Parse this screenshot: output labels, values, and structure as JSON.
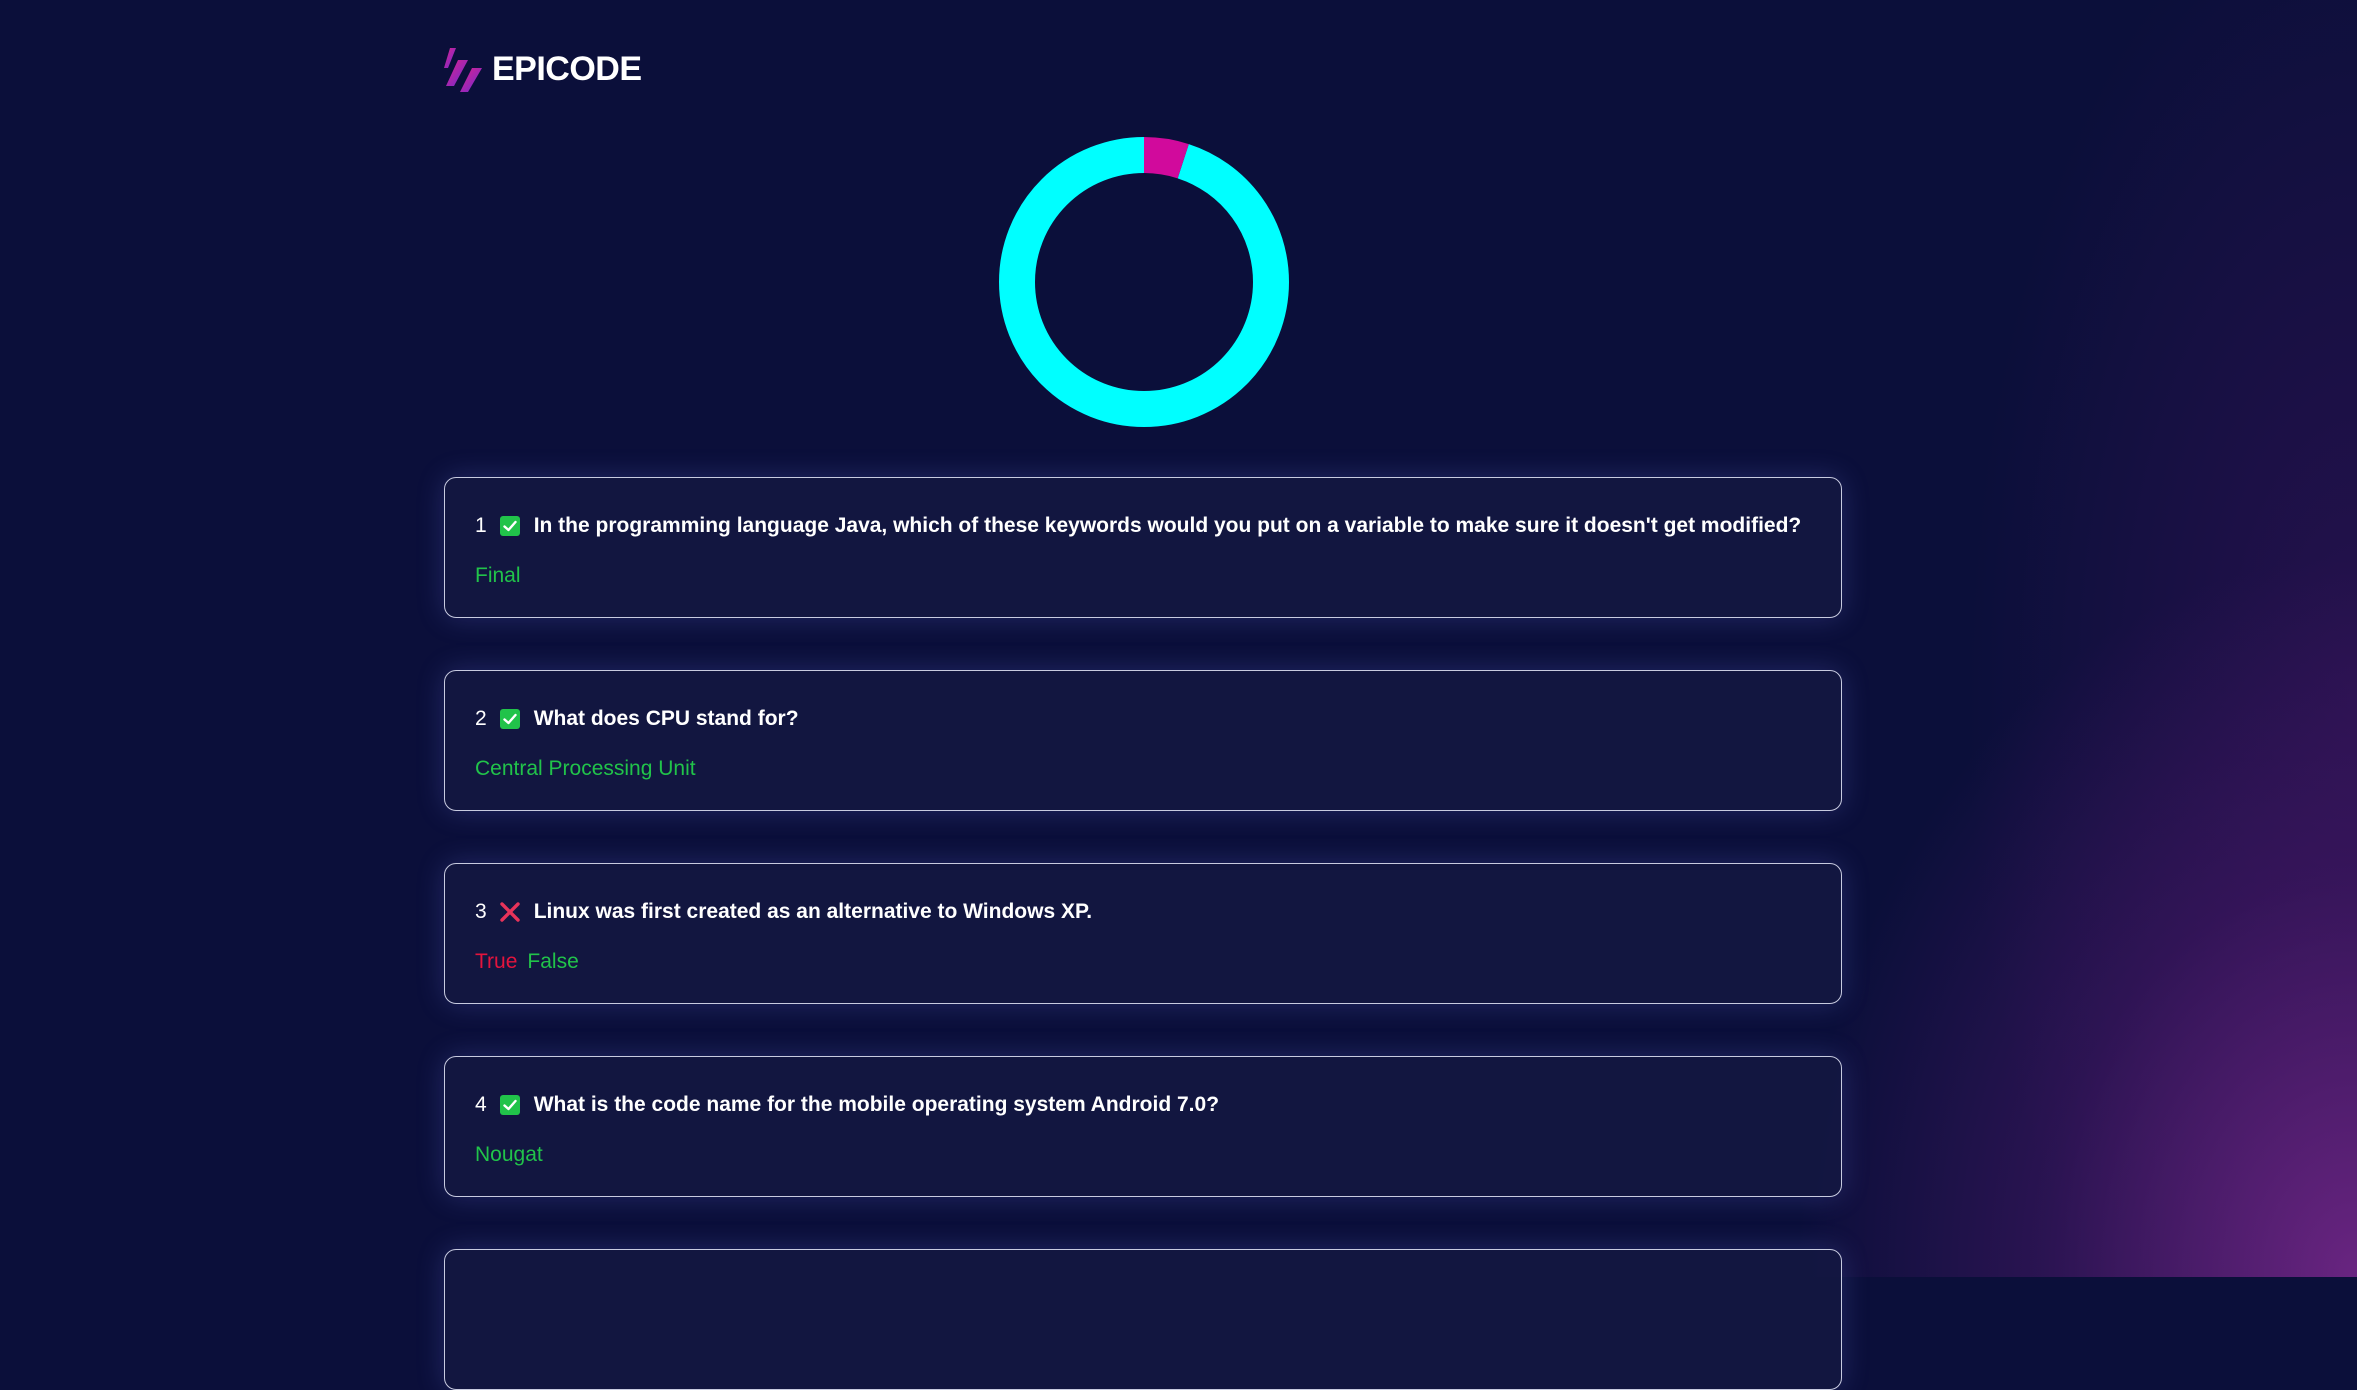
{
  "brand": {
    "name": "EPICODE"
  },
  "colors": {
    "background": "#0b0f3a",
    "correct": "#21c34a",
    "wrong": "#e3143d",
    "donut_correct": "#00ffff",
    "donut_wrong": "#d10a9c"
  },
  "score": {
    "correct_fraction": 0.95,
    "wrong_fraction": 0.05
  },
  "questions": [
    {
      "number": "1",
      "status": "correct",
      "status_icon": "check-icon",
      "text": "In the programming language Java, which of these keywords would you put on a variable to make sure it doesn't get modified?",
      "wrong_answer": "",
      "correct_answer": "Final"
    },
    {
      "number": "2",
      "status": "correct",
      "status_icon": "check-icon",
      "text": "What does CPU stand for?",
      "wrong_answer": "",
      "correct_answer": "Central Processing Unit"
    },
    {
      "number": "3",
      "status": "wrong",
      "status_icon": "cross-icon",
      "text": "Linux was first created as an alternative to Windows XP.",
      "wrong_answer": "True",
      "correct_answer": "False"
    },
    {
      "number": "4",
      "status": "correct",
      "status_icon": "check-icon",
      "text": "What is the code name for the mobile operating system Android 7.0?",
      "wrong_answer": "",
      "correct_answer": "Nougat"
    }
  ]
}
